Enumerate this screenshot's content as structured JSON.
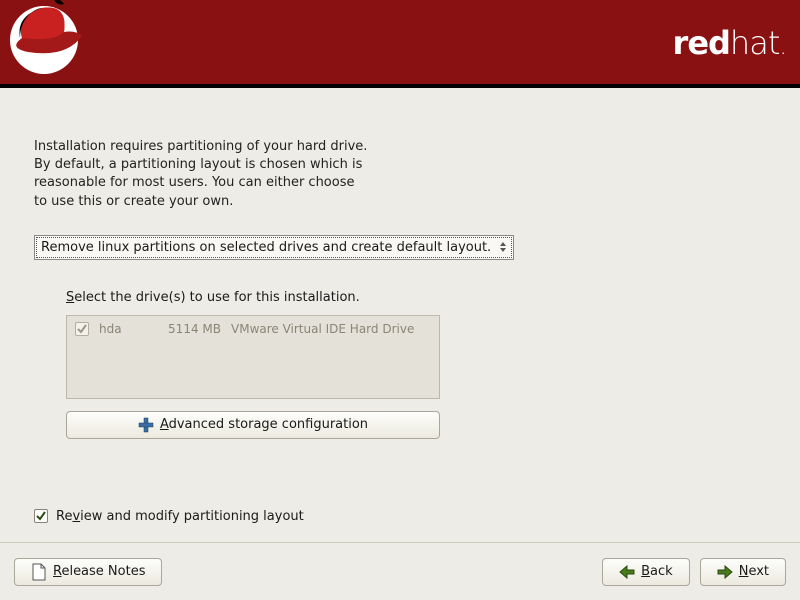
{
  "brand": {
    "bold": "red",
    "light": "hat"
  },
  "intro": {
    "l1": "Installation requires partitioning of your hard drive.",
    "l2": "By default, a partitioning layout is chosen which is",
    "l3": "reasonable for most users.  You can either choose",
    "l4": "to use this or create your own."
  },
  "combo": {
    "selected": "Remove linux partitions on selected drives and create default layout."
  },
  "drives": {
    "prompt_pre": "S",
    "prompt_post": "elect the drive(s) to use for this installation.",
    "row": {
      "name": "hda",
      "size": "5114 MB",
      "desc": "VMware Virtual IDE Hard Drive"
    }
  },
  "adv": {
    "pre": "A",
    "post": "dvanced storage configuration"
  },
  "review": {
    "pre": "Re",
    "mid": "v",
    "post": "iew and modify partitioning layout"
  },
  "footer": {
    "release_pre": "R",
    "release_post": "elease Notes",
    "back_pre": "B",
    "back_post": "ack",
    "next_pre": "N",
    "next_post": "ext"
  }
}
